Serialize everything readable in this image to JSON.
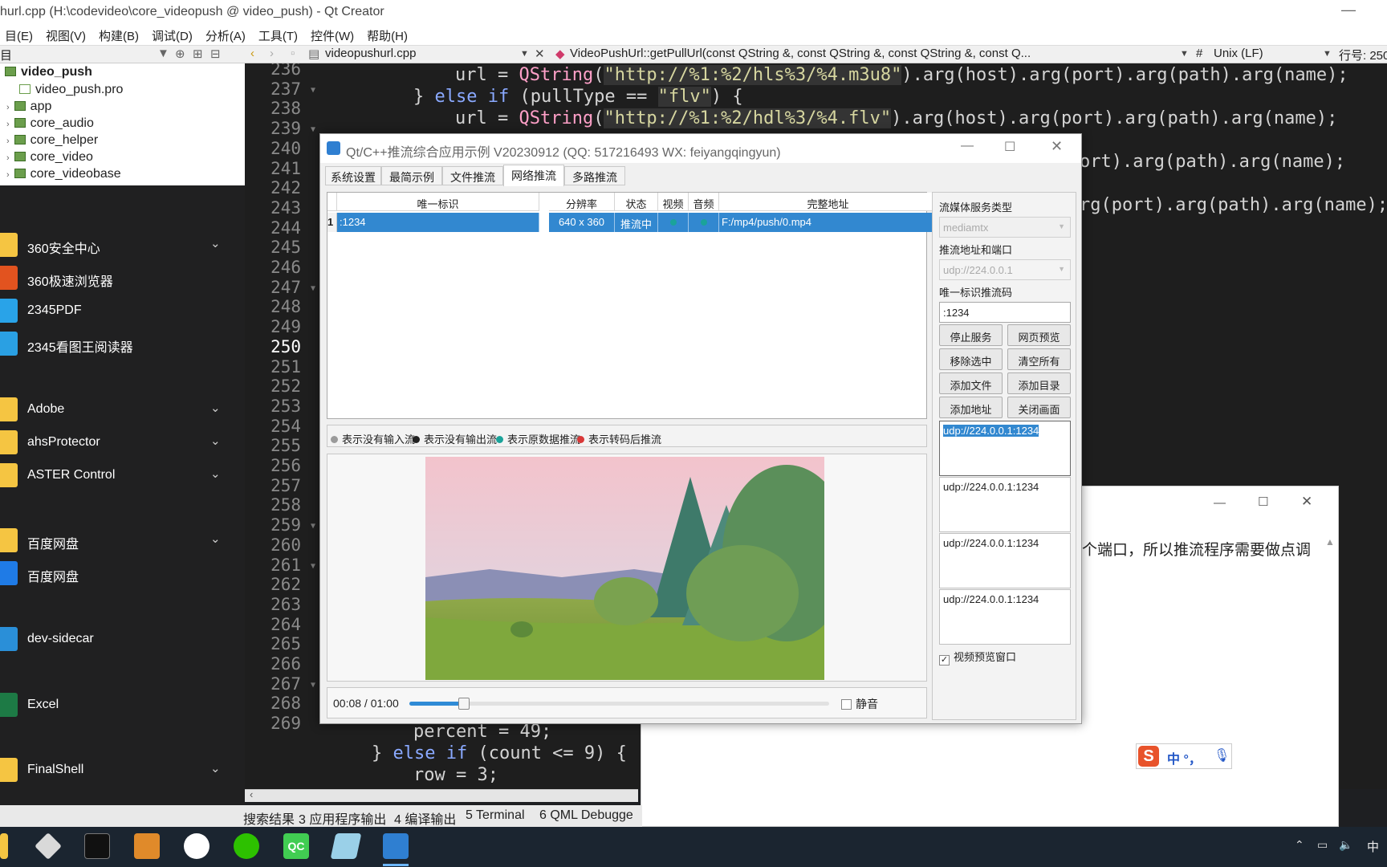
{
  "ide": {
    "title": "hurl.cpp (H:\\codevideo\\core_videopush @ video_push) - Qt Creator",
    "menu": [
      "目(E)",
      "视图(V)",
      "构建(B)",
      "调试(D)",
      "分析(A)",
      "工具(T)",
      "控件(W)",
      "帮助(H)"
    ],
    "toolbar": {
      "left_label": "目",
      "file_tab": "videopushurl.cpp",
      "function": "VideoPushUrl::getPullUrl(const QString &, const QString &, const QString &, const Q...",
      "hash": "#",
      "line_ending": "Unix (LF)",
      "line_label": "行号: 250"
    },
    "tree": [
      {
        "label": "video_push",
        "bold": true
      },
      {
        "label": "video_push.pro"
      },
      {
        "label": "app"
      },
      {
        "label": "core_audio"
      },
      {
        "label": "core_helper"
      },
      {
        "label": "core_video"
      },
      {
        "label": "core_videobase"
      }
    ],
    "status_tabs": [
      "搜索结果",
      "3 应用程序输出",
      "4 编译输出",
      "5 Terminal",
      "6 QML Debugge"
    ]
  },
  "start_menu": {
    "items": [
      {
        "label": "360安全中心",
        "expand": true,
        "color": "#f5c542"
      },
      {
        "label": "360极速浏览器",
        "expand": false,
        "color": "#e2531f"
      },
      {
        "label": "2345PDF",
        "expand": false,
        "color": "#29a3e8"
      },
      {
        "label": "2345看图王阅读器",
        "expand": false,
        "color": "#2aa0e3"
      },
      {
        "label": "Adobe",
        "expand": true,
        "color": "#f5c542"
      },
      {
        "label": "ahsProtector",
        "expand": true,
        "color": "#f5c542"
      },
      {
        "label": "ASTER Control",
        "expand": true,
        "color": "#f5c542"
      },
      {
        "label": "百度网盘",
        "expand": true,
        "color": "#f5c542"
      },
      {
        "label": "百度网盘",
        "expand": false,
        "color": "#1f7be6"
      },
      {
        "label": "dev-sidecar",
        "expand": false,
        "color": "#2a8fd8"
      },
      {
        "label": "Excel",
        "expand": false,
        "color": "#1d7a45"
      },
      {
        "label": "FinalShell",
        "expand": true,
        "color": "#f5c542"
      }
    ]
  },
  "editor": {
    "line_numbers": [
      "236",
      "237",
      "238",
      "239",
      "240",
      "241",
      "242",
      "243",
      "244",
      "245",
      "246",
      "247",
      "248",
      "249",
      "250",
      "251",
      "252",
      "253",
      "254",
      "255",
      "256",
      "257",
      "258",
      "259",
      "260",
      "261",
      "262",
      "263",
      "264",
      "265",
      "266",
      "267",
      "268",
      "269"
    ],
    "current_line": "250",
    "frag_240": "ort).arg(path).arg(name);",
    "frag_242": "rg(port).arg(path).arg(name);"
  },
  "app": {
    "title": "Qt/C++推流综合应用示例 V20230912 (QQ: 517216493 WX: feiyangqingyun)",
    "tabs": [
      "系统设置",
      "最简示例",
      "文件推流",
      "网络推流",
      "多路推流"
    ],
    "active_tab": "网络推流",
    "table": {
      "headers": [
        "唯一标识",
        "分辨率",
        "状态",
        "视频",
        "音频",
        "完整地址"
      ],
      "rows": [
        {
          "index": "1",
          "id": ":1234",
          "resolution": "640 x 360",
          "status": "推流中",
          "video": "",
          "audio": "",
          "address": "F:/mp4/push/0.mp4"
        }
      ]
    },
    "legend": [
      {
        "label": "表示没有输入流",
        "color": "#9a9a9a"
      },
      {
        "label": "表示没有输出流",
        "color": "#222222"
      },
      {
        "label": "表示原数据推流",
        "color": "#1aa39a"
      },
      {
        "label": "表示转码后推流",
        "color": "#d93838"
      }
    ],
    "player": {
      "time": "00:08 / 01:00",
      "progress": 0.13,
      "mute_label": "静音",
      "mute_checked": false
    },
    "right": {
      "service_type_label": "流媒体服务类型",
      "service_type": "mediamtx",
      "push_addr_label": "推流地址和端口",
      "push_addr": "udp://224.0.0.1",
      "id_label": "唯一标识推流码",
      "id_value": ":1234",
      "buttons": [
        "停止服务",
        "网页预览",
        "移除选中",
        "清空所有",
        "添加文件",
        "添加目录",
        "添加地址",
        "关闭画面"
      ],
      "urls": [
        "udp://224.0.0.1:1234",
        "udp://224.0.0.1:1234",
        "udp://224.0.0.1:1234",
        "udp://224.0.0.1:1234"
      ],
      "preview_label": "视频预览窗口",
      "preview_checked": true
    }
  },
  "doc": {
    "text": "个端口，所以推流程序需要做点调"
  },
  "ime": {
    "text": "中 °，"
  },
  "systray": {
    "lang": "中"
  },
  "colors": {
    "selection": "#3288d0",
    "accent": "#1aa39a"
  }
}
